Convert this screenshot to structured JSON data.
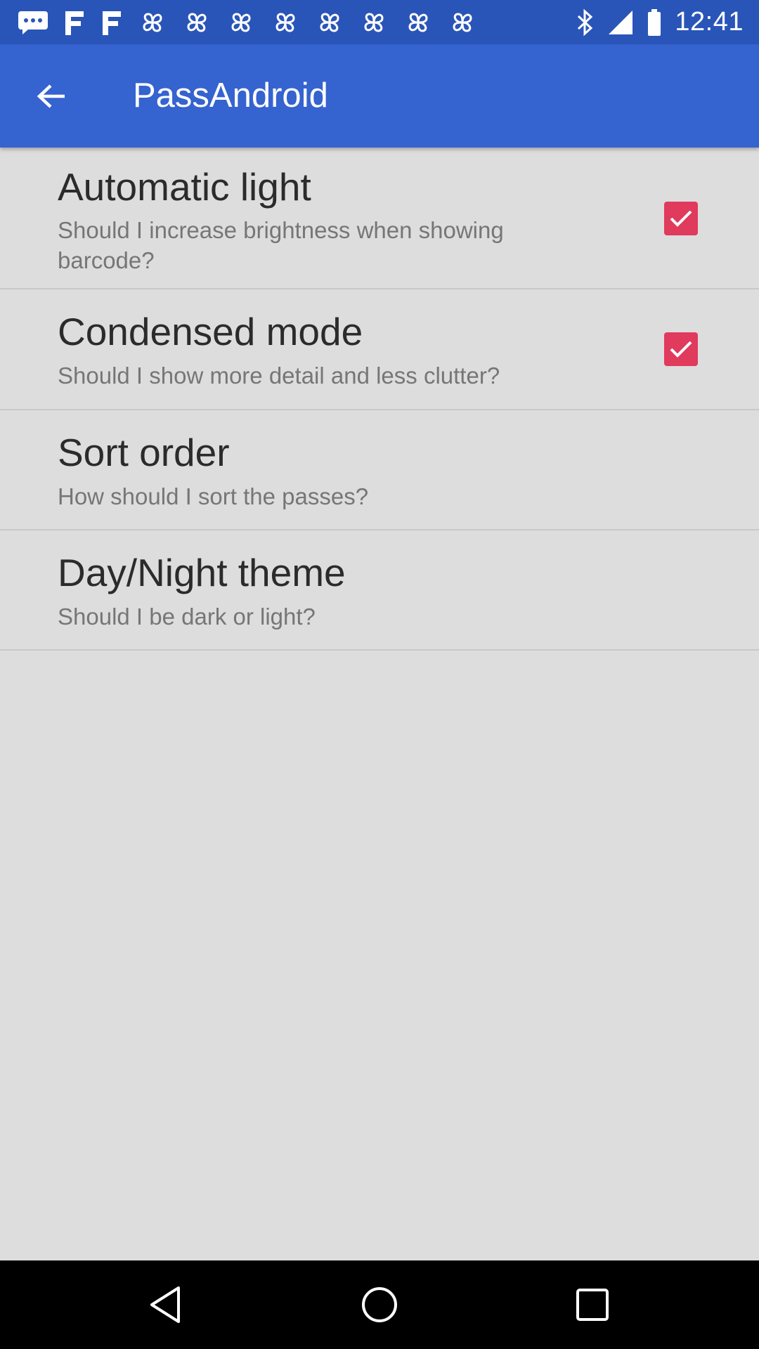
{
  "status_bar": {
    "time": "12:41",
    "left_icons": [
      "chat-icon",
      "fan-icon",
      "fan-icon",
      "pinwheel-icon",
      "pinwheel-icon",
      "pinwheel-icon",
      "pinwheel-icon",
      "pinwheel-icon",
      "pinwheel-icon",
      "pinwheel-icon",
      "pinwheel-icon",
      "pinwheel-icon"
    ],
    "right_icons": [
      "bluetooth-icon",
      "signal-icon",
      "battery-icon"
    ]
  },
  "app_bar": {
    "title": "PassAndroid",
    "back_icon": "arrow-back-icon",
    "color": "#3563cf"
  },
  "settings": [
    {
      "title": "Automatic light",
      "summary": "Should I increase brightness when showing barcode?",
      "checkbox": true,
      "checked": true
    },
    {
      "title": "Condensed mode",
      "summary": "Should I show more detail and less clutter?",
      "checkbox": true,
      "checked": true
    },
    {
      "title": "Sort order",
      "summary": "How should I sort the passes?",
      "checkbox": false
    },
    {
      "title": "Day/Night theme",
      "summary": "Should I be dark or light?",
      "checkbox": false
    }
  ],
  "accent_color": "#e03a5c",
  "nav_bar": {
    "buttons": [
      "back-triangle-icon",
      "home-circle-icon",
      "recents-square-icon"
    ]
  }
}
